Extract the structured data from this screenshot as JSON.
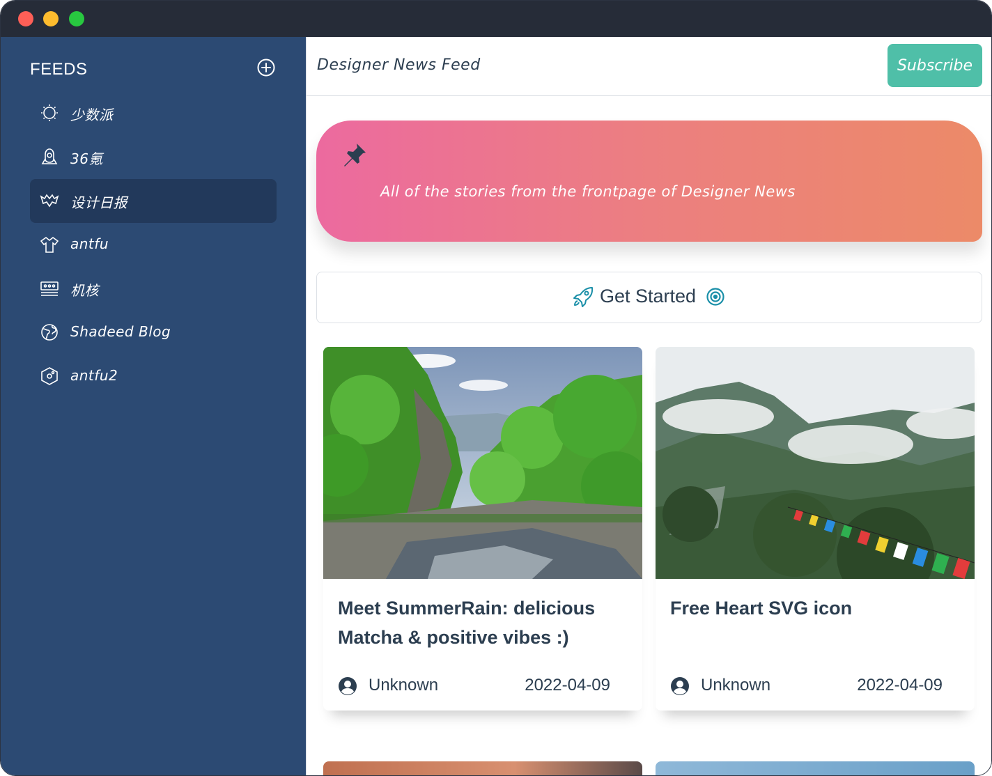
{
  "window": {
    "controls": [
      "close",
      "minimize",
      "zoom"
    ]
  },
  "sidebar": {
    "title": "FEEDS",
    "add_icon": "plus-circle-icon",
    "items": [
      {
        "label": "少数派",
        "icon": "sun-icon",
        "active": false
      },
      {
        "label": "36氪",
        "icon": "astronaut-icon",
        "active": false
      },
      {
        "label": "设计日报",
        "icon": "bat-icon",
        "active": true
      },
      {
        "label": "antfu",
        "icon": "shirt-icon",
        "active": false
      },
      {
        "label": "机核",
        "icon": "server-icon",
        "active": false
      },
      {
        "label": "Shadeed Blog",
        "icon": "globe-icon",
        "active": false
      },
      {
        "label": "antfu2",
        "icon": "hexagon-icon",
        "active": false
      }
    ]
  },
  "header": {
    "feed_name": "Designer News Feed",
    "subscribe_label": "Subscribe"
  },
  "banner": {
    "icon": "pushpin-icon",
    "text": "All of the stories from the frontpage of Designer News"
  },
  "get_started": {
    "label": "Get Started",
    "left_icon": "rocket-icon",
    "right_icon": "target-icon"
  },
  "cards": [
    {
      "title": "Meet SummerRain: delicious Matcha & positive vibes :)",
      "author": "Unknown",
      "date": "2022-04-09",
      "author_icon": "user-circle-icon"
    },
    {
      "title": "Free Heart SVG icon",
      "author": "Unknown",
      "date": "2022-04-09",
      "author_icon": "user-circle-icon"
    }
  ],
  "colors": {
    "titlebar": "#262c38",
    "sidebar": "#2c4a73",
    "sidebar_active": "#22395b",
    "accent": "#4fbfa8",
    "text_dark": "#2c3e50",
    "banner_start": "#ec6a9f",
    "banner_end": "#ec8a68"
  }
}
